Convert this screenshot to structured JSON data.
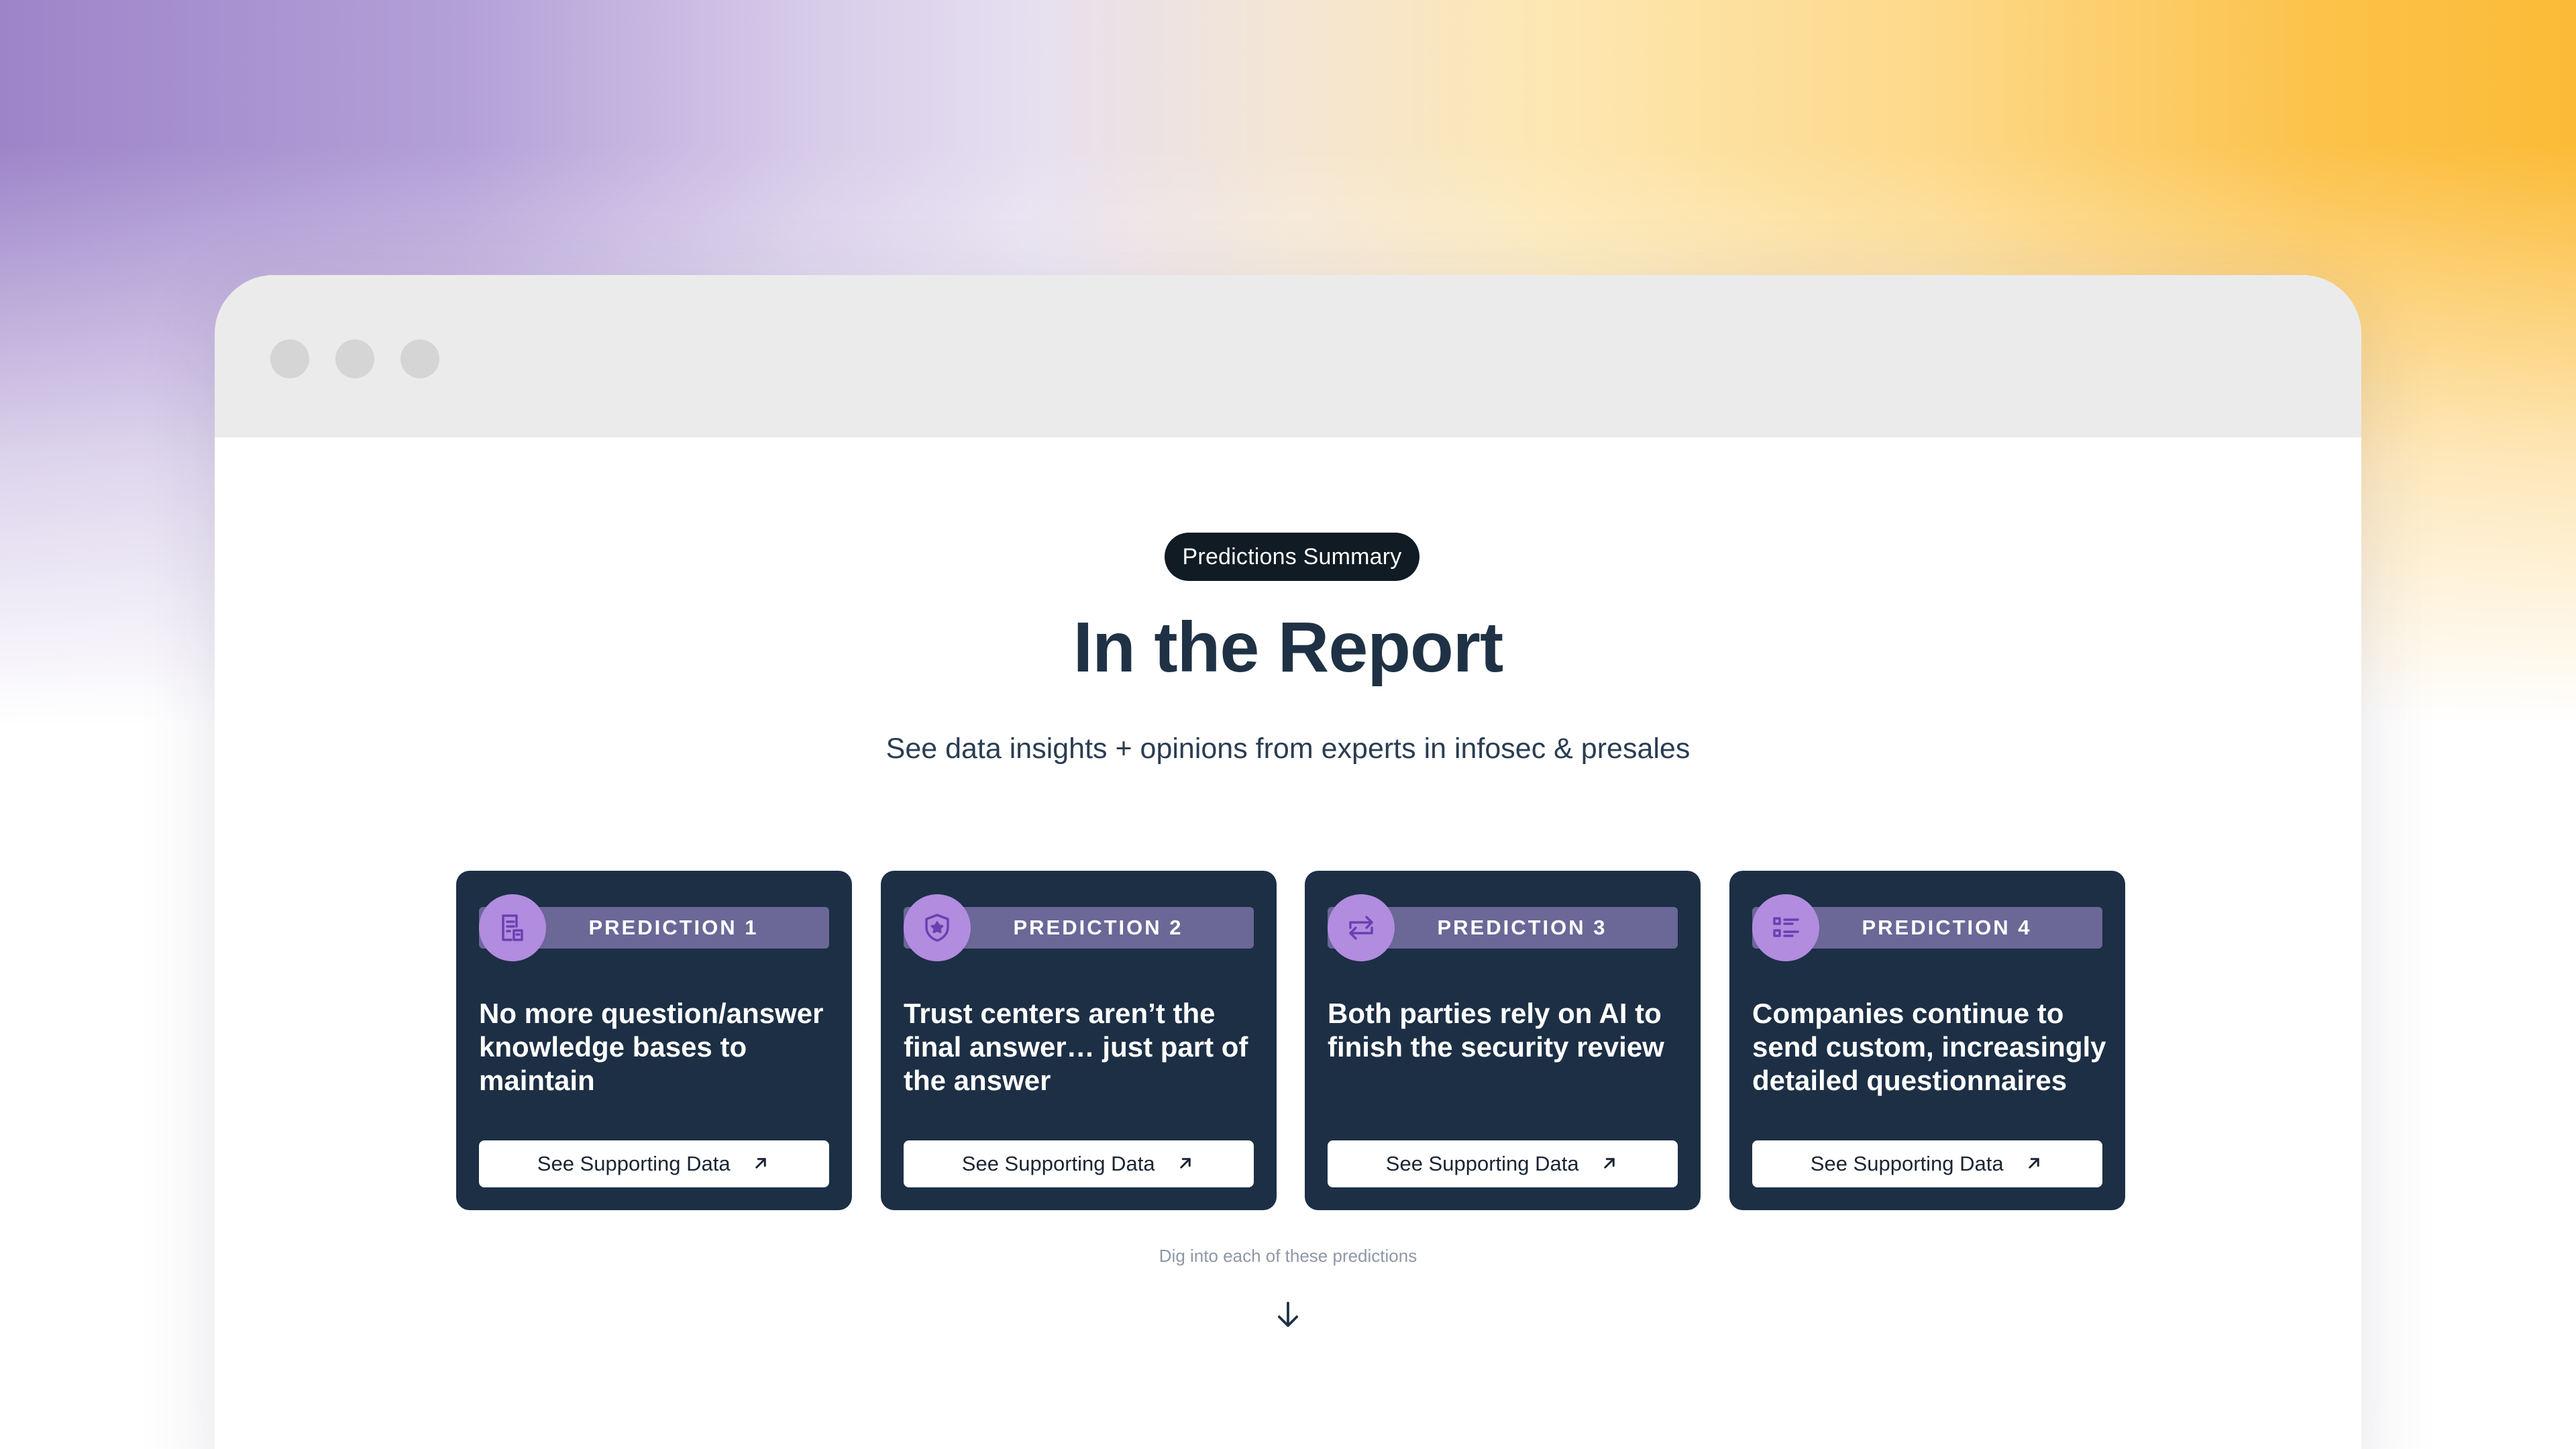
{
  "badge": "Predictions Summary",
  "heading": "In the Report",
  "subtitle": "See data insights + opinions from experts in infosec & presales",
  "cards": [
    {
      "label": "PREDICTION 1",
      "title": "No more question/answer knowledge bases to maintain",
      "button": "See Supporting Data",
      "icon": "document-icon"
    },
    {
      "label": "PREDICTION 2",
      "title": "Trust centers aren’t the final answer… just part of the answer",
      "button": "See Supporting Data",
      "icon": "shield-star-icon"
    },
    {
      "label": "PREDICTION 3",
      "title": "Both parties rely on AI to finish the security review",
      "button": "See Supporting Data",
      "icon": "swap-arrows-icon"
    },
    {
      "label": "PREDICTION 4",
      "title": "Companies continue to send custom, increasingly detailed questionnaires",
      "button": "See Supporting Data",
      "icon": "checklist-icon"
    }
  ],
  "footer_hint": "Dig into each of these predictions",
  "colors": {
    "card_bg": "#1c2f45",
    "label_bar": "#6b6797",
    "icon_circle": "#b18cdf",
    "icon_stroke": "#6a3fb0",
    "badge_bg": "#101b24",
    "heading": "#1f3245"
  }
}
